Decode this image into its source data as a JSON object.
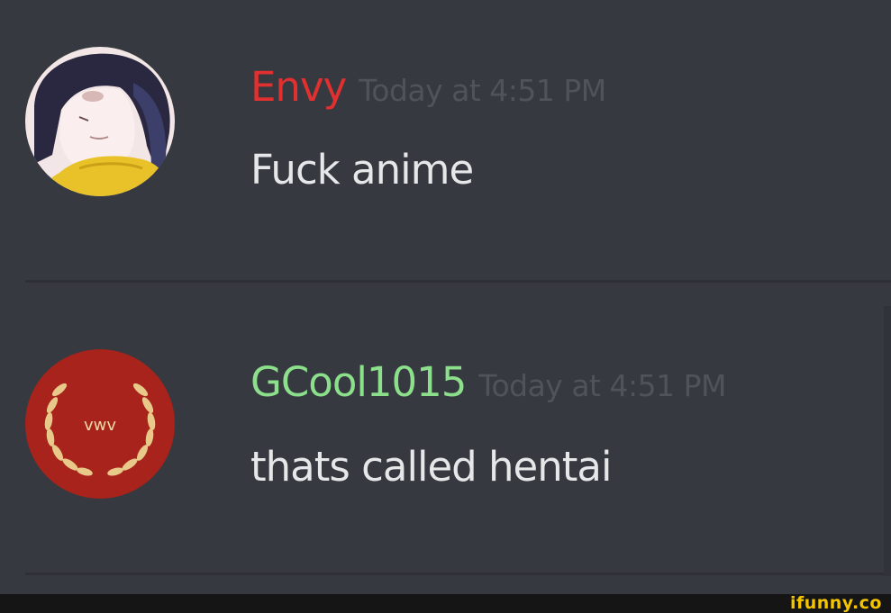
{
  "messages": [
    {
      "username": "Envy",
      "username_color": "#e03030",
      "timestamp": "Today at 4:51 PM",
      "text": "Fuck anime",
      "avatar": "anime-girl-avatar-icon"
    },
    {
      "username": "GCool1015",
      "username_color": "#8ce08c",
      "timestamp": "Today at 4:51 PM",
      "text": "thats called hentai",
      "avatar": "laurel-wreath-avatar-icon",
      "avatar_text": "vwv"
    }
  ],
  "watermark": "ifunny.co",
  "colors": {
    "background": "#36393f",
    "message_text": "#e6e7e8",
    "timestamp": "#4f535a",
    "watermark": "#f5c400"
  }
}
